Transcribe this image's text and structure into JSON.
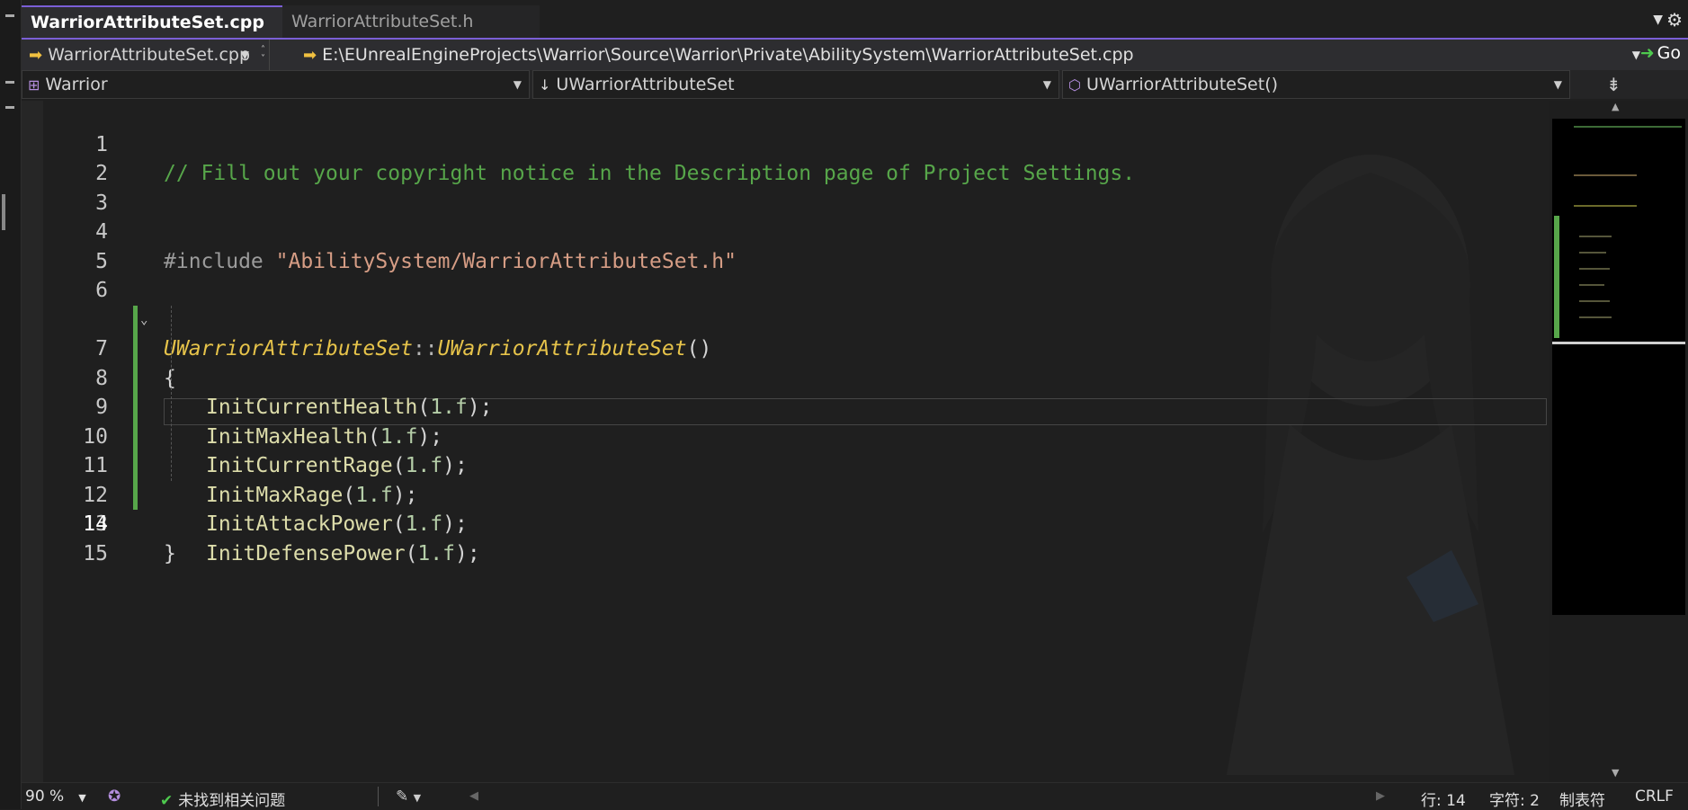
{
  "tabs": [
    {
      "label": "WarriorAttributeSet.cpp",
      "active": true,
      "pin": "⊣",
      "close": "✕"
    },
    {
      "label": "WarriorAttributeSet.h",
      "active": false
    }
  ],
  "file_nav": {
    "file": "WarriorAttributeSet.cpp",
    "path": "E:\\EUnrealEngineProjects\\Warrior\\Source\\Warrior\\Private\\AbilitySystem\\WarriorAttributeSet.cpp",
    "go_label": "Go"
  },
  "scope": {
    "project": "Warrior",
    "class": "UWarriorAttributeSet",
    "member": "UWarriorAttributeSet()"
  },
  "code": {
    "line_numbers": [
      "1",
      "2",
      "3",
      "4",
      "5",
      "6",
      "7",
      "8",
      "9",
      "10",
      "11",
      "12",
      "13",
      "14",
      "15"
    ],
    "current_line": "14",
    "line1_comment": "// Fill out your copyright notice in the Description page of Project Settings.",
    "line4_directive": "#include ",
    "line4_string": "\"AbilitySystem/WarriorAttributeSet.h\"",
    "line6_class": "UWarriorAttributeSet",
    "line6_scope": "::",
    "line6_ctor": "UWarriorAttributeSet",
    "line6_parens": "()",
    "open_brace": "{",
    "close_brace": "}",
    "calls": [
      {
        "name": "InitCurrentHealth",
        "arg": "1.f"
      },
      {
        "name": "InitMaxHealth",
        "arg": "1.f"
      },
      {
        "name": "InitCurrentRage",
        "arg": "1.f"
      },
      {
        "name": "InitMaxRage",
        "arg": "1.f"
      },
      {
        "name": "InitAttackPower",
        "arg": "1.f"
      },
      {
        "name": "InitDefensePower",
        "arg": "1.f"
      }
    ]
  },
  "status": {
    "zoom": "90 %",
    "issues": "未找到相关问题",
    "line": "行: 14",
    "char": "字符: 2",
    "indent": "制表符",
    "eol": "CRLF"
  },
  "colors": {
    "accent": "#7b5fd6",
    "comment": "#57a64a",
    "type": "#e6c34a",
    "string": "#d69d85",
    "function": "#dcdcaa",
    "number": "#b5cea8"
  },
  "icons": {
    "file_arrow": "arrow-right-icon",
    "go": "go-icon",
    "ok": "check-circle-icon"
  }
}
